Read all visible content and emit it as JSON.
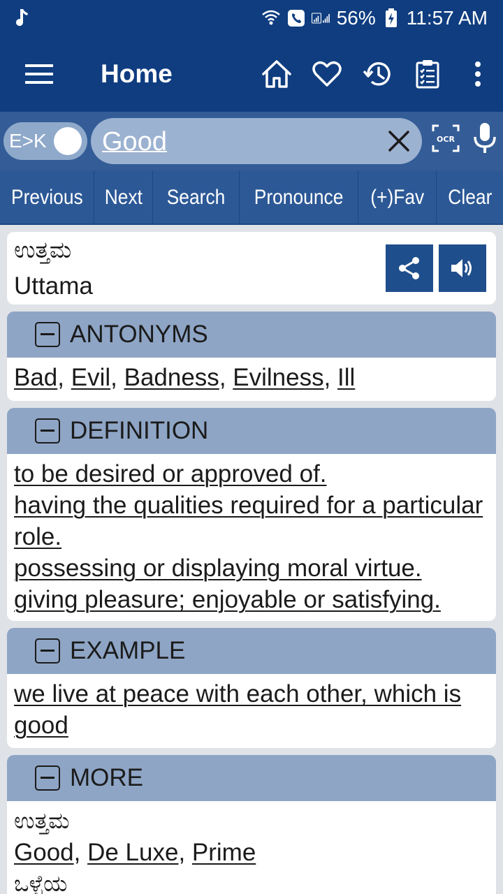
{
  "status": {
    "battery": "56%",
    "time": "11:57 AM"
  },
  "appbar": {
    "title": "Home"
  },
  "search": {
    "mode": "E>K",
    "query": "Good"
  },
  "actions": [
    "Previous",
    "Next",
    "Search",
    "Pronounce",
    "(+)Fav",
    "Clear"
  ],
  "result": {
    "word_kannada": "ಉತ್ತಮ",
    "transliteration": "Uttama"
  },
  "sections": {
    "antonyms": {
      "title": "ANTONYMS",
      "items": [
        "Bad",
        "Evil",
        "Badness",
        "Evilness",
        "Ill"
      ]
    },
    "definition": {
      "title": "DEFINITION",
      "lines": [
        "to be desired or approved of.",
        "having the qualities required for a particular role.",
        "possessing or displaying moral virtue.",
        "giving pleasure; enjoyable or satisfying."
      ]
    },
    "example": {
      "title": "EXAMPLE",
      "text": "we live at peace with each other, which is good"
    },
    "more": {
      "title": "MORE",
      "kannada_1": "ಉತ್ತಮ",
      "synonyms": [
        "Good",
        "De Luxe",
        "Prime"
      ],
      "kannada_2": "ಒಳ್ಳೆಯ"
    }
  },
  "colors": {
    "primary": "#0f3d80",
    "secondary": "#2c5896",
    "section_header": "#8ea5c5"
  },
  "icons": [
    "music-note-icon",
    "wifi-call-icon",
    "phone-icon",
    "signal-icon",
    "battery-icon",
    "menu-icon",
    "home-icon",
    "heart-icon",
    "history-icon",
    "clipboard-icon",
    "more-vert-icon",
    "close-icon",
    "ocr-icon",
    "mic-icon",
    "share-icon",
    "speaker-icon",
    "collapse-icon"
  ]
}
